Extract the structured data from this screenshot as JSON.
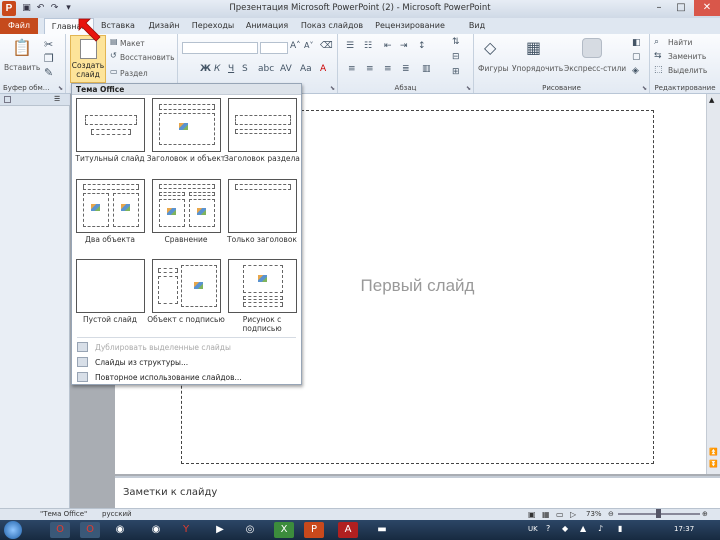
{
  "window": {
    "title": "Презентация Microsoft PowerPoint (2) - Microsoft PowerPoint",
    "app_logo_letter": "P",
    "controls": {
      "minimize": "–",
      "maximize": "□",
      "close": "✕"
    }
  },
  "tabs": {
    "file": "Файл",
    "items": [
      "Главная",
      "Вставка",
      "Дизайн",
      "Переходы",
      "Анимация",
      "Показ слайдов",
      "Рецензирование",
      "Вид"
    ]
  },
  "ribbon": {
    "clipboard": {
      "paste": "Вставить",
      "label": "Буфер обм..."
    },
    "slides": {
      "new_slide": "Создать слайд",
      "layout": "Макет",
      "reset": "Восстановить",
      "section": "Раздел"
    },
    "paragraph": {
      "label": "Абзац"
    },
    "drawing": {
      "shapes": "Фигуры",
      "arrange": "Упорядочить",
      "styles": "Экспресс-стили",
      "label": "Рисование"
    },
    "editing": {
      "find": "Найти",
      "replace": "Заменить",
      "select": "Выделить",
      "label": "Редактирование"
    }
  },
  "dropdown": {
    "header": "Тема Office",
    "layouts": [
      {
        "label": "Титульный слайд"
      },
      {
        "label": "Заголовок и объект"
      },
      {
        "label": "Заголовок раздела"
      },
      {
        "label": "Два объекта"
      },
      {
        "label": "Сравнение"
      },
      {
        "label": "Только заголовок"
      },
      {
        "label": "Пустой слайд"
      },
      {
        "label": "Объект с подписью"
      },
      {
        "label": "Рисунок с подписью"
      }
    ],
    "actions": [
      {
        "label": "Дублировать выделенные слайды",
        "enabled": false
      },
      {
        "label": "Слайды из структуры...",
        "enabled": true
      },
      {
        "label": "Повторное использование слайдов...",
        "enabled": true
      }
    ]
  },
  "slide": {
    "title": "Первый слайд"
  },
  "notes": {
    "placeholder": "Заметки к слайду"
  },
  "status": {
    "theme": "\"Тема Office\"",
    "language": "русский",
    "zoom": "73%"
  },
  "taskbar": {
    "lang": "UK",
    "time": "17:37"
  }
}
